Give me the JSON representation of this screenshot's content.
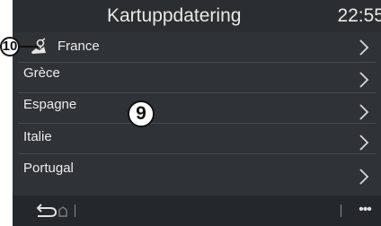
{
  "header": {
    "title": "Kartuppdatering",
    "clock": "22:55"
  },
  "list": {
    "items": [
      {
        "label": "France",
        "icon": "map-update-icon",
        "chevron": "chevron-right-icon"
      },
      {
        "label": "Grèce",
        "chevron": "chevron-right-icon"
      },
      {
        "label": "Espagne",
        "chevron": "chevron-right-icon"
      },
      {
        "label": "Italie",
        "chevron": "chevron-right-icon"
      },
      {
        "label": "Portugal",
        "chevron": "chevron-right-icon"
      }
    ]
  },
  "footer": {
    "back_icon": "back-icon",
    "more_label": "•••"
  },
  "callouts": {
    "ten": "10",
    "nine": "9"
  },
  "colors": {
    "background": "#2c2f33",
    "text": "#ececec",
    "divider": "#474b51"
  }
}
